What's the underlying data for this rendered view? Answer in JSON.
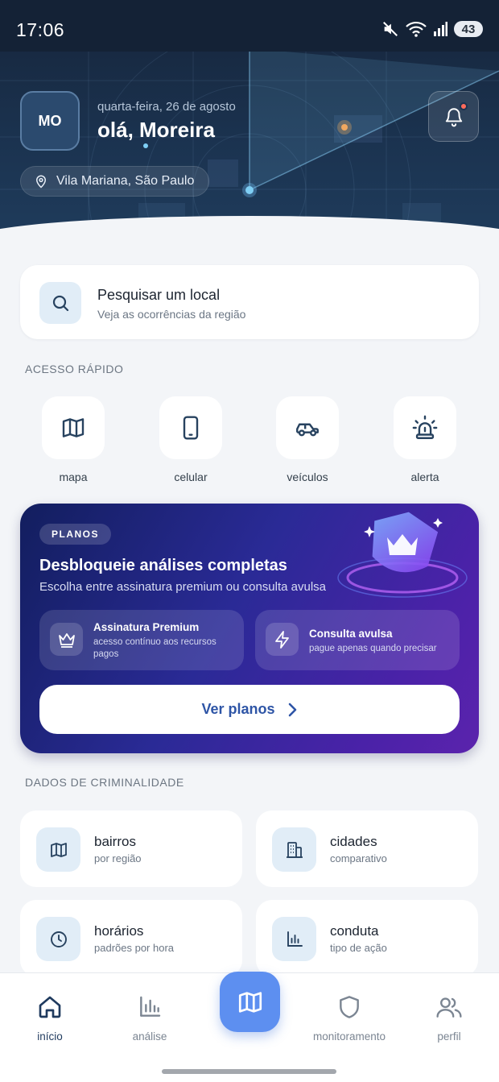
{
  "status_bar": {
    "time": "17:06",
    "battery": "43"
  },
  "header": {
    "avatar_initials": "MO",
    "date": "quarta-feira, 26 de agosto",
    "greeting": "olá, Moreira",
    "location": "Vila Mariana, São Paulo"
  },
  "search": {
    "title": "Pesquisar um local",
    "subtitle": "Veja as ocorrências da região"
  },
  "quick_access": {
    "label": "ACESSO RÁPIDO",
    "items": [
      {
        "label": "mapa",
        "icon": "map-icon"
      },
      {
        "label": "celular",
        "icon": "phone-icon"
      },
      {
        "label": "veículos",
        "icon": "car-icon"
      },
      {
        "label": "alerta",
        "icon": "siren-icon"
      }
    ]
  },
  "plans": {
    "badge": "PLANOS",
    "title": "Desbloqueie análises completas",
    "subtitle": "Escolha entre assinatura premium ou consulta avulsa",
    "options": [
      {
        "title": "Assinatura Premium",
        "subtitle_line1": "acesso contínuo aos recursos",
        "subtitle_line2": "pagos",
        "icon": "crown-icon"
      },
      {
        "title": "Consulta avulsa",
        "subtitle": "pague apenas quando precisar",
        "icon": "lightning-icon"
      }
    ],
    "button": "Ver planos"
  },
  "crime_data": {
    "label": "DADOS DE CRIMINALIDADE",
    "items": [
      {
        "title": "bairros",
        "subtitle": "por região",
        "icon": "map-icon"
      },
      {
        "title": "cidades",
        "subtitle": "comparativo",
        "icon": "building-icon"
      },
      {
        "title": "horários",
        "subtitle": "padrões por hora",
        "icon": "clock-icon"
      },
      {
        "title": "conduta",
        "subtitle": "tipo de ação",
        "icon": "bar-chart-icon"
      }
    ]
  },
  "bottom_nav": {
    "items": [
      {
        "label": "início",
        "icon": "home-icon",
        "active": true
      },
      {
        "label": "análise",
        "icon": "bar-chart-icon"
      },
      {
        "label": "",
        "icon": "map-icon"
      },
      {
        "label": "monitoramento",
        "icon": "shield-icon"
      },
      {
        "label": "perfil",
        "icon": "users-icon"
      }
    ]
  },
  "colors": {
    "header_bg": "#1b3350",
    "accent": "#5d8ff0",
    "plans_bg": "#2a2a96",
    "button_text": "#2e55a6"
  }
}
